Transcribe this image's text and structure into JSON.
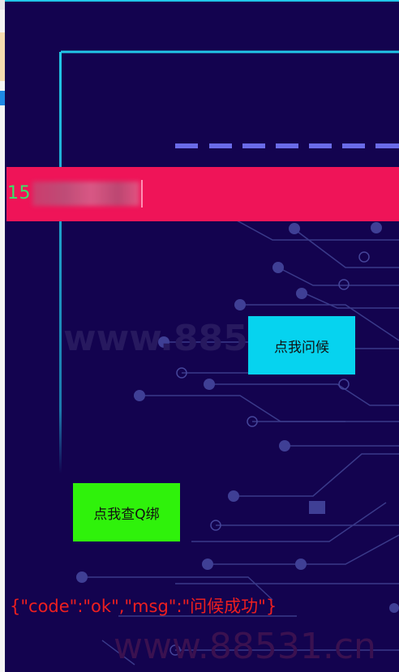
{
  "phone_input": {
    "value": "15"
  },
  "buttons": {
    "greet_label": "点我问候",
    "bind_label": "点我查Q绑"
  },
  "result_text": "{\"code\":\"ok\",\"msg\":\"问候成功\"}",
  "watermark": {
    "top": "www.88531.cn",
    "bottom": "www.88531.cn"
  },
  "colors": {
    "background": "#13034f",
    "accent_line": "#21c7e8",
    "phone_bar": "#ef1458",
    "phone_text": "#39e46a",
    "greet_button": "#06d3ef",
    "bind_button": "#2ff20b",
    "result_text": "#ee1f1f"
  }
}
